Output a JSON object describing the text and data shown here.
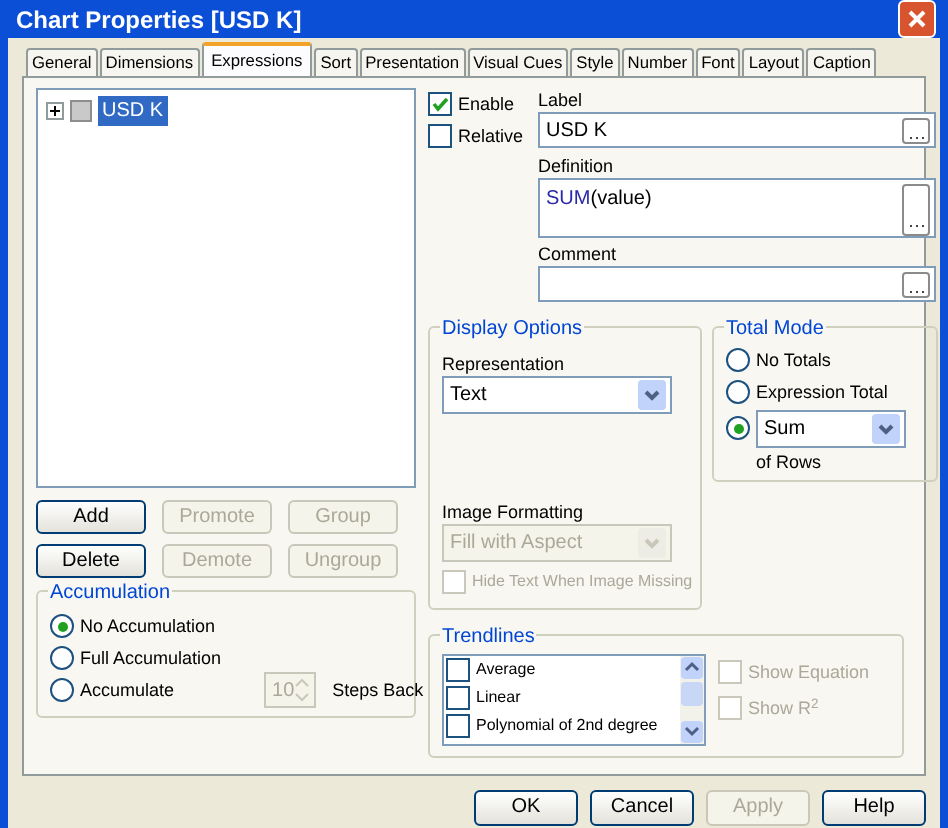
{
  "window": {
    "title": "Chart Properties [USD K]"
  },
  "tabs": [
    {
      "label": "General",
      "selected": false
    },
    {
      "label": "Dimensions",
      "selected": false
    },
    {
      "label": "Expressions",
      "selected": true
    },
    {
      "label": "Sort",
      "selected": false
    },
    {
      "label": "Presentation",
      "selected": false
    },
    {
      "label": "Visual Cues",
      "selected": false
    },
    {
      "label": "Style",
      "selected": false
    },
    {
      "label": "Number",
      "selected": false
    },
    {
      "label": "Font",
      "selected": false
    },
    {
      "label": "Layout",
      "selected": false
    },
    {
      "label": "Caption",
      "selected": false
    }
  ],
  "expression_tree": [
    {
      "label": "USD K",
      "selected": true,
      "expanded": false
    }
  ],
  "expression_buttons": [
    {
      "label": "Add",
      "disabled": false
    },
    {
      "label": "Promote",
      "disabled": true
    },
    {
      "label": "Group",
      "disabled": true
    },
    {
      "label": "Delete",
      "disabled": false
    },
    {
      "label": "Demote",
      "disabled": true
    },
    {
      "label": "Ungroup",
      "disabled": true
    }
  ],
  "accumulation": {
    "title": "Accumulation",
    "options": [
      {
        "label": "No Accumulation",
        "selected": true
      },
      {
        "label": "Full Accumulation",
        "selected": false
      },
      {
        "label": "Accumulate",
        "selected": false
      }
    ],
    "steps": {
      "value": "10",
      "disabled": true,
      "label": "Steps Back"
    }
  },
  "flags": [
    {
      "label": "Enable",
      "checked": true
    },
    {
      "label": "Relative",
      "checked": false
    }
  ],
  "label_field": {
    "label": "Label",
    "value": "USD K"
  },
  "definition_field": {
    "label": "Definition",
    "tokens": [
      {
        "text": "SUM",
        "kind": "function"
      },
      {
        "text": "(value)",
        "kind": "plain"
      }
    ]
  },
  "comment_field": {
    "label": "Comment"
  },
  "display_options": {
    "title": "Display Options",
    "representation_label": "Representation",
    "representation": "Text",
    "image_formatting_label": "Image Formatting",
    "image_formatting": {
      "value": "Fill with Aspect",
      "disabled": true
    },
    "hide_text": {
      "label": "Hide Text When Image Missing",
      "checked": false,
      "disabled": true
    }
  },
  "total_mode": {
    "title": "Total Mode",
    "options": [
      {
        "label": "No Totals",
        "selected": false
      },
      {
        "label": "Expression Total",
        "selected": false
      },
      {
        "value": "Sum",
        "selected": true
      }
    ],
    "suffix": "of Rows"
  },
  "trendlines": {
    "title": "Trendlines",
    "items": [
      {
        "label": "Average",
        "checked": false
      },
      {
        "label": "Linear",
        "checked": false
      },
      {
        "label": "Polynomial of 2nd degree",
        "checked": false
      }
    ],
    "options": [
      {
        "label": "Show Equation",
        "checked": false,
        "disabled": true
      },
      {
        "label": "Show R$^{2}$",
        "checked": false,
        "disabled": true
      }
    ]
  },
  "footer_buttons": [
    {
      "label": "OK",
      "disabled": false
    },
    {
      "label": "Cancel",
      "disabled": false
    },
    {
      "label": "Apply",
      "disabled": true
    },
    {
      "label": "Help",
      "disabled": false
    }
  ]
}
